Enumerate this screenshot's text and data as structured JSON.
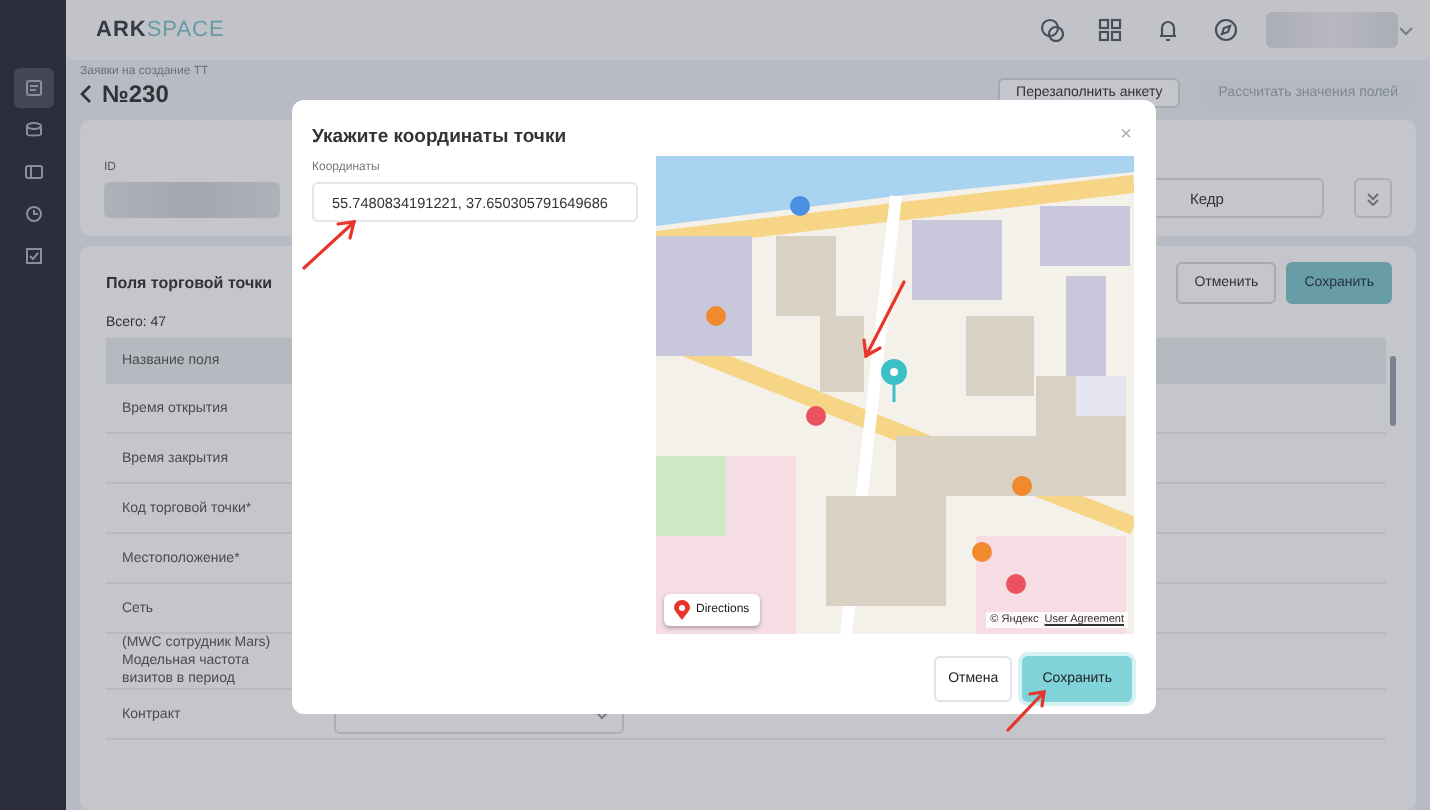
{
  "topbar": {
    "logo_primary": "ARK",
    "logo_secondary": "SPACE"
  },
  "sidebar": {
    "items": [
      {
        "selected": true
      },
      {
        "selected": false
      },
      {
        "selected": false
      },
      {
        "selected": false
      },
      {
        "selected": false
      }
    ]
  },
  "page": {
    "breadcrumb": "Заявки на создание ТТ",
    "title": "№230",
    "actions": [
      {
        "label": "Перезаполнить анкету",
        "disabled": false
      },
      {
        "label": "Рассчитать значения полей",
        "disabled": true
      }
    ],
    "id_field": {
      "label": "ID"
    },
    "brand_field": {
      "value": "Кедр"
    },
    "fields_card": {
      "title": "Поля торговой точки",
      "total": "Всего: 47",
      "buttons": [
        {
          "label": "Отменить",
          "primary": false
        },
        {
          "label": "Сохранить",
          "primary": true
        }
      ],
      "table": {
        "columns": [
          "Название поля"
        ],
        "rows": [
          {
            "name": "Время открытия",
            "kind": "text"
          },
          {
            "name": "Время закрытия",
            "kind": "text"
          },
          {
            "name": "Код торговой точки*",
            "kind": "text"
          },
          {
            "name": "Местоположение*",
            "kind": "text"
          },
          {
            "name": "Сеть",
            "kind": "text"
          },
          {
            "name": "(MWC сотрудник Mars) Модельная частота визитов в период",
            "kind": "text"
          },
          {
            "name": "Контракт",
            "kind": "select"
          }
        ]
      }
    }
  },
  "dialog": {
    "title": "Укажите координаты точки",
    "close": "×",
    "field_label": "Координаты",
    "value": "55.7480834191221, 37.650305791649686",
    "map": {
      "directions": "Directions",
      "copyright": "© Яндекс",
      "agreement": "User Agreement"
    },
    "buttons": [
      {
        "label": "Отмена",
        "primary": false
      },
      {
        "label": "Сохранить",
        "primary": true
      }
    ]
  }
}
